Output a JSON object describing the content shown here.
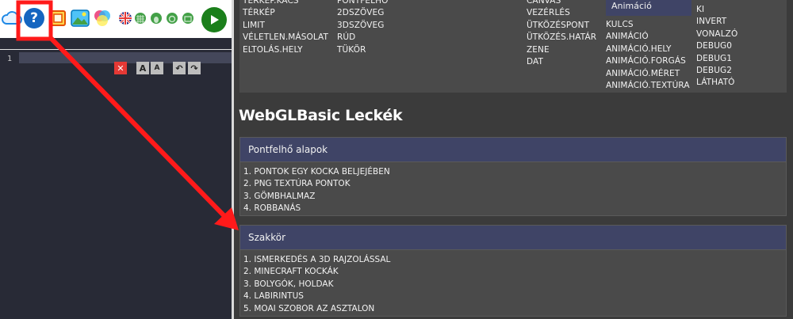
{
  "toolbar": {
    "icons": [
      "cloud-icon",
      "help-icon",
      "gallery-icon",
      "image-icon",
      "palette-icon",
      "uk-flag-icon",
      "grid-icon",
      "bug-icon",
      "circle-icon",
      "window-icon"
    ],
    "run_icon": "play-icon"
  },
  "editor": {
    "line_number": "1"
  },
  "top_columns": {
    "col1": [
      "TERKEP.KACS",
      "TÉRKÉP",
      "LIMIT",
      "VÉLETLEN.MÁSOLAT",
      "ELTOLÁS.HELY"
    ],
    "col2": [
      "PONTFELHŐ",
      "2DSZÖVEG",
      "3DSZÖVEG",
      "RÚD",
      "TÜKÖR"
    ],
    "col3": [
      "CANVAS",
      "VEZÉRLÉS",
      "ÜTKÖZÉSPONT",
      "ÜTKÖZÉS.HATÁR",
      "ZENE",
      "DAT"
    ],
    "anim_header": "Animáció",
    "col4": [
      "KULCS",
      "ANIMÁCIÓ",
      "ANIMÁCIÓ.HELY",
      "ANIMÁCIÓ.FORGÁS",
      "ANIMÁCIÓ.MÉRET",
      "ANIMÁCIÓ.TEXTÚRA"
    ],
    "col5": [
      "KI",
      "INVERT",
      "VONALZÓ",
      "DEBUG0",
      "DEBUG1",
      "DEBUG2",
      "LÁTHATÓ"
    ]
  },
  "section_title": "WebGLBasic Leckék",
  "cards": [
    {
      "title": "Pontfelhő alapok",
      "items": [
        "1. PONTOK EGY KOCKA BELJEJÉBEN",
        "2. PNG TEXTÚRA PONTOK",
        "3. GÖMBHALMAZ",
        "4. ROBBANÁS"
      ]
    },
    {
      "title": "Szakkör",
      "items": [
        "1. ISMERKEDÉS A 3D RAJZOLÁSSAL",
        "2. MINECRAFT KOCKÁK",
        "3. BOLYGÓK, HOLDAK",
        "4. LABIRINTUS",
        "5. MOAI SZOBOR AZ ASZTALON"
      ]
    }
  ],
  "colors": {
    "highlight_box": "#ff1a1a",
    "arrow": "#ff1a1a",
    "card_header": "#3f4466"
  }
}
